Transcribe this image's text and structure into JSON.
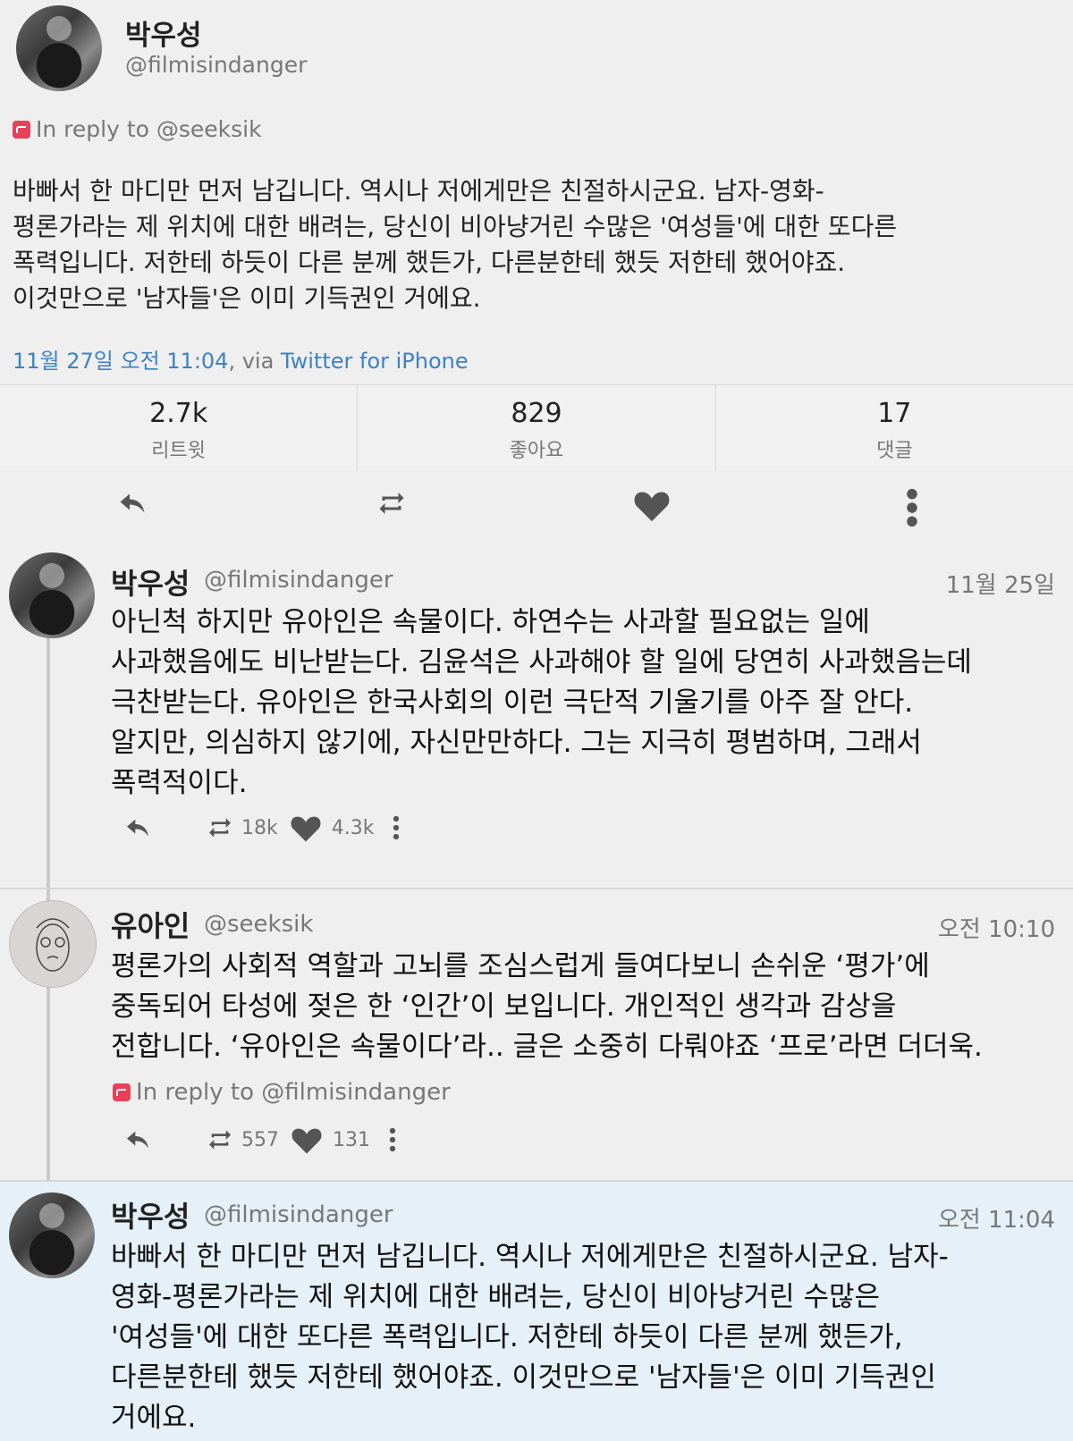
{
  "main_tweet": {
    "name": "박우성",
    "handle": "@filmisindanger",
    "in_reply_to": "In reply to @seeksik",
    "text": "바빠서 한 마디만 먼저 남깁니다. 역시나 저에게만은 친절하시군요. 남자-영화-\n평론가라는 제 위치에 대한 배려는, 당신이 비아냥거린 수많은 '여성들'에 대한 또다른\n폭력입니다. 저한테 하듯이 다른 분께 했든가, 다른분한테 했듯 저한테 했어야죠.\n이것만으로 '남자들'은 이미 기득권인 거에요.",
    "timestamp": "11월 27일 오전 11:04",
    "via_sep": ", via ",
    "via_app": "Twitter for iPhone",
    "stats": [
      {
        "value": "2.7k",
        "label": "리트윗"
      },
      {
        "value": "829",
        "label": "좋아요"
      },
      {
        "value": "17",
        "label": "댓글"
      }
    ]
  },
  "timeline": [
    {
      "name": "박우성",
      "handle": "@filmisindanger",
      "time": "11월 25일",
      "text": "아닌척 하지만 유아인은 속물이다. 하연수는 사과할 필요없는 일에\n사과했음에도 비난받는다. 김윤석은 사과해야 할 일에 당연히 사과했음는데\n극찬받는다. 유아인은 한국사회의 이런 극단적 기울기를 아주 잘 안다.\n알지만, 의심하지 않기에, 자신만만하다. 그는 지극히 평범하며, 그래서\n폭력적이다.",
      "retweets": "18k",
      "likes": "4.3k"
    },
    {
      "name": "유아인",
      "handle": "@seeksik",
      "time": "오전 10:10",
      "text": "평론가의 사회적 역할과 고뇌를 조심스럽게 들여다보니 손쉬운 ‘평가’에\n중독되어 타성에 젖은 한 ‘인간’이 보입니다. 개인적인 생각과 감상을\n전합니다. ‘유아인은 속물이다’라.. 글은 소중히 다뤄야죠 ‘프로’라면 더더욱.",
      "in_reply_to": "In reply to @filmisindanger",
      "retweets": "557",
      "likes": "131"
    },
    {
      "name": "박우성",
      "handle": "@filmisindanger",
      "time": "오전 11:04",
      "text": "바빠서 한 마디만 먼저 남깁니다. 역시나 저에게만은 친절하시군요. 남자-\n영화-평론가라는 제 위치에 대한 배려는, 당신이 비아냥거린 수많은\n'여성들'에 대한 또다른 폭력입니다. 저한테 하듯이 다른 분께 했든가,\n다른분한테 했듯 저한테 했어야죠. 이것만으로 '남자들'은 이미 기득권인\n거에요."
    }
  ],
  "colors": {
    "accent": "#3d82c4",
    "reply_badge": "#e8405a",
    "highlight": "#e6f0f8"
  },
  "icons": [
    "reply-icon",
    "retweet-icon",
    "like-icon",
    "more-icon",
    "in-reply-icon"
  ]
}
